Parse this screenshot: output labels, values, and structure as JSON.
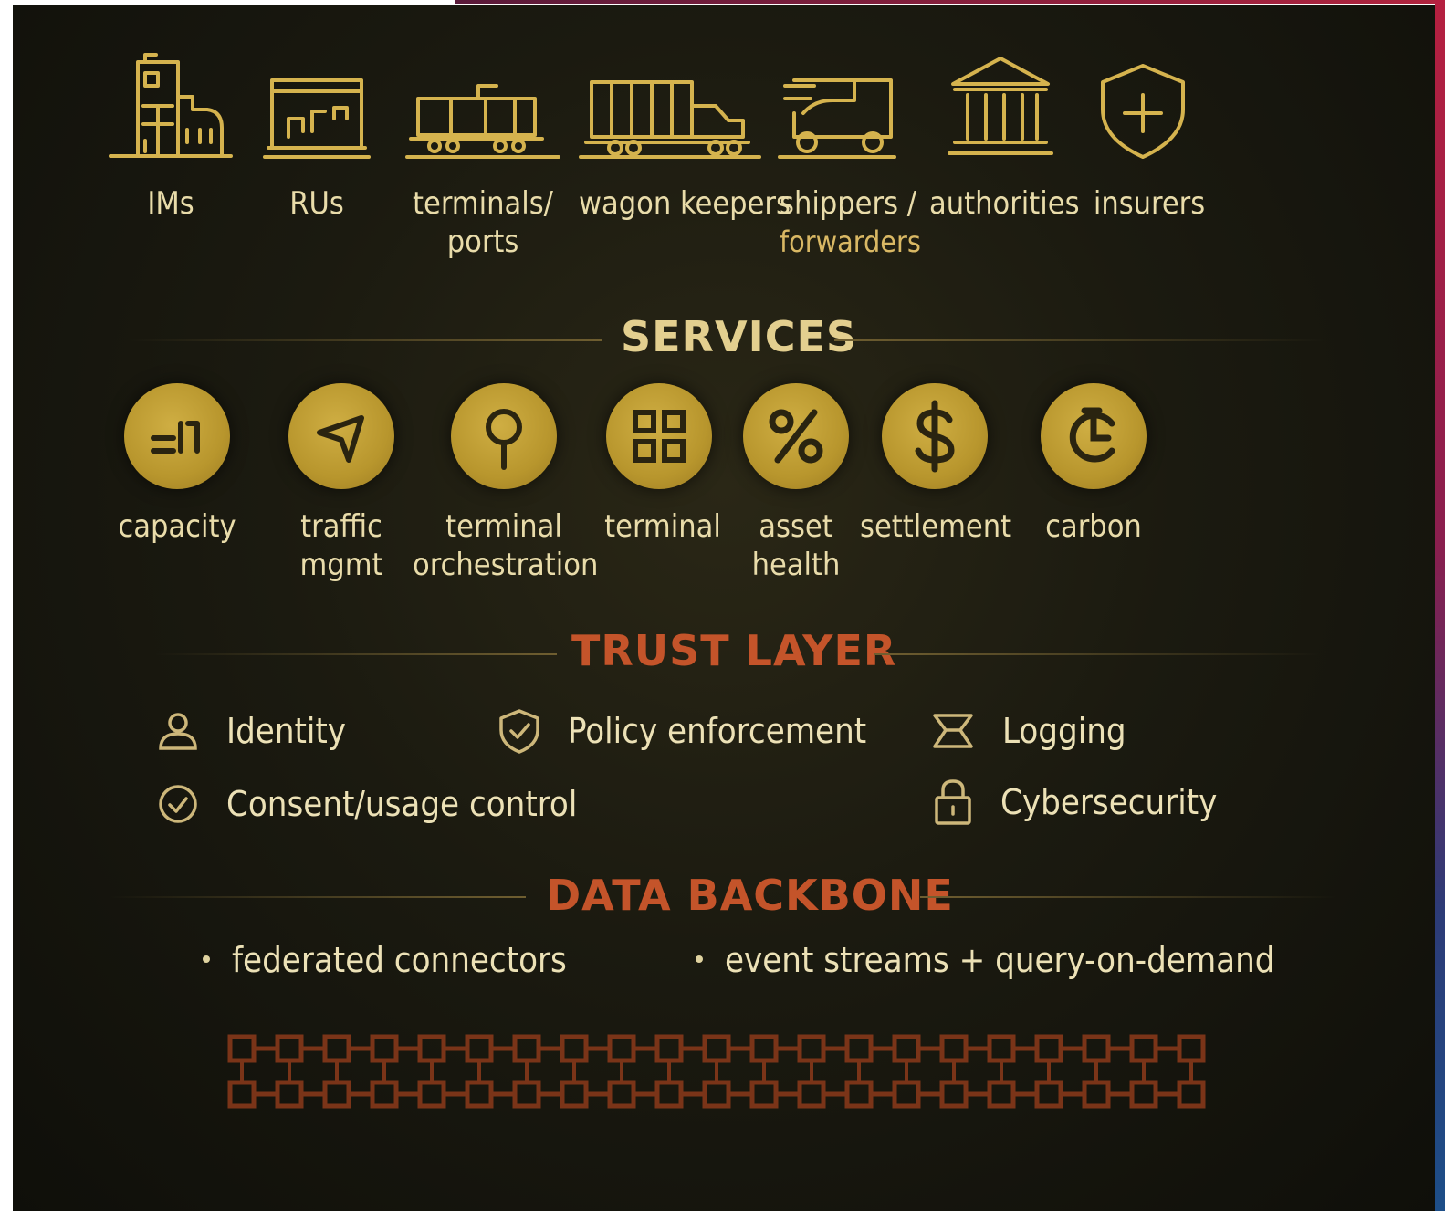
{
  "stakeholders": [
    {
      "id": "ims",
      "label": "IMs",
      "sub": ""
    },
    {
      "id": "rus",
      "label": "RUs",
      "sub": ""
    },
    {
      "id": "terminals",
      "label": "terminals/",
      "sub": "ports"
    },
    {
      "id": "wagon",
      "label": "wagon keepers",
      "sub": ""
    },
    {
      "id": "shippers",
      "label": "shippers /",
      "sub": "forwarders"
    },
    {
      "id": "authorities",
      "label": "authorities",
      "sub": ""
    },
    {
      "id": "insurers",
      "label": "insurers",
      "sub": ""
    }
  ],
  "services": {
    "title": "SERVICES",
    "items": [
      {
        "line1": "capacity",
        "line2": ""
      },
      {
        "line1": "traffic",
        "line2": "mgmt"
      },
      {
        "line1": "terminal",
        "line2": "orchestration"
      },
      {
        "line1": "terminal",
        "line2": ""
      },
      {
        "line1": "asset",
        "line2": "health"
      },
      {
        "line1": "settlement",
        "line2": ""
      },
      {
        "line1": "carbon",
        "line2": ""
      }
    ]
  },
  "trust_layer": {
    "title": "TRUST LAYER",
    "items": [
      {
        "label": "Identity",
        "icon": "user-icon"
      },
      {
        "label": "Policy enforcement",
        "icon": "shield-check-icon"
      },
      {
        "label": "Logging",
        "icon": "log-icon"
      },
      {
        "label": "Consent/usage control",
        "icon": "check-circle-icon"
      },
      {
        "label": "Cybersecurity",
        "icon": "lock-icon"
      }
    ]
  },
  "data_backbone": {
    "title": "DATA BACKBONE",
    "bullets": [
      "federated connectors",
      "event streams + query-on-demand"
    ]
  },
  "colors": {
    "gold": "#d5b34e",
    "services_title": "#e3cf8f",
    "trust_title": "#c4542a",
    "backbone_title": "#c4542a",
    "chain": "#7a3418"
  }
}
